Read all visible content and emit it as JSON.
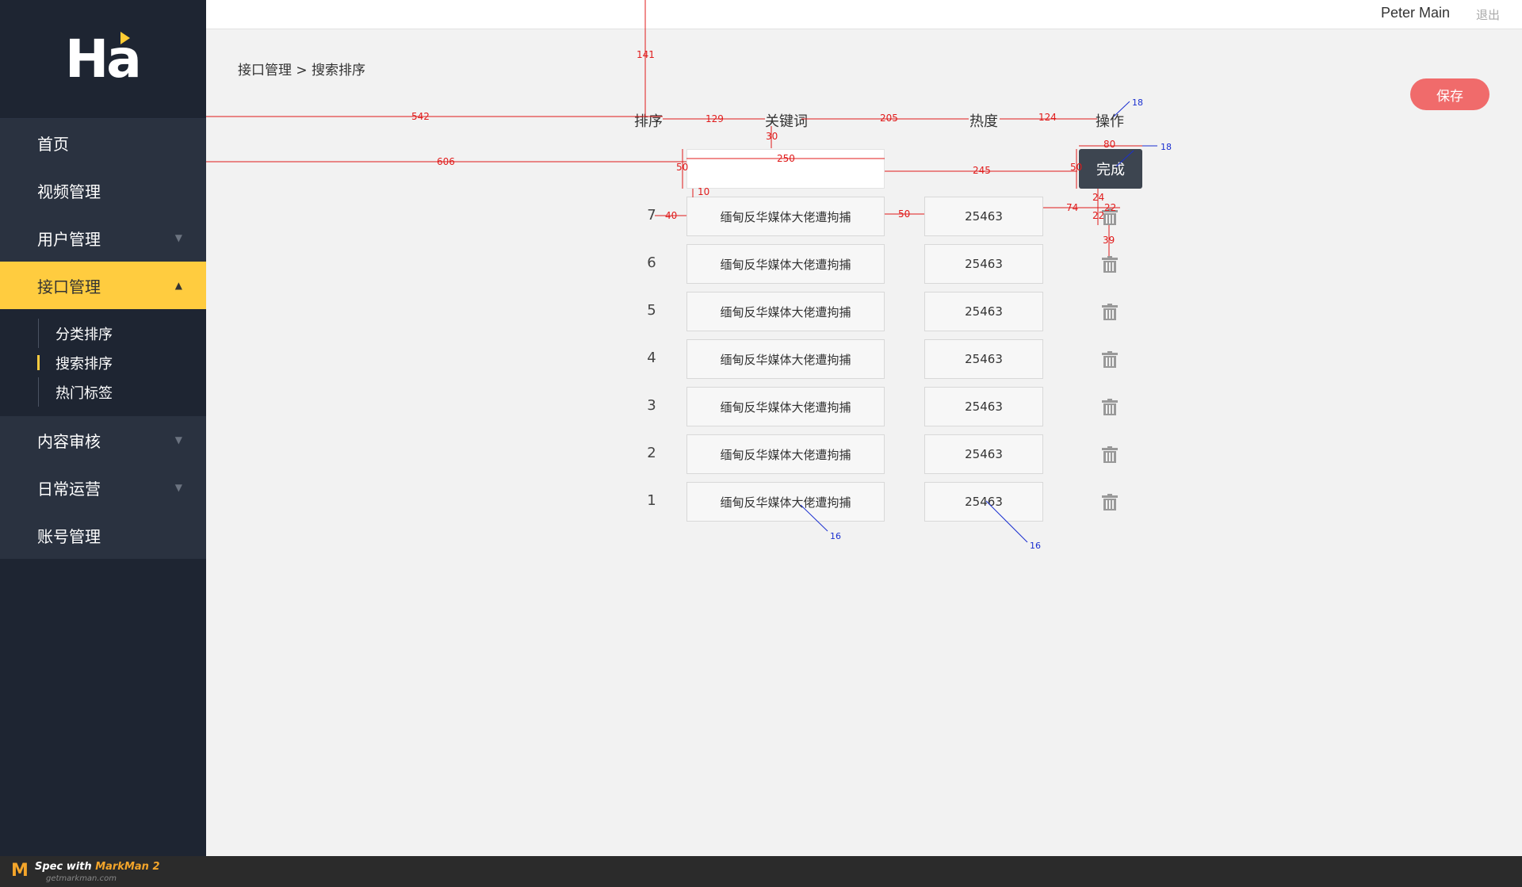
{
  "sidebar": {
    "logo": "Ha",
    "items": [
      {
        "label": "首页"
      },
      {
        "label": "视频管理"
      },
      {
        "label": "用户管理",
        "arrow": "▼"
      },
      {
        "label": "接口管理",
        "arrow": "▲"
      },
      {
        "label": "内容审核",
        "arrow": "▼"
      },
      {
        "label": "日常运营",
        "arrow": "▼"
      },
      {
        "label": "账号管理"
      }
    ],
    "submenu": [
      {
        "label": "分类排序"
      },
      {
        "label": "搜索排序"
      },
      {
        "label": "热门标签"
      }
    ]
  },
  "header": {
    "user_name": "Peter Main",
    "logout_label": "退出"
  },
  "breadcrumb": "接口管理 > 搜索排序",
  "save_label": "保存",
  "table": {
    "headers": [
      "排序",
      "关键词",
      "热度",
      "操作"
    ],
    "new_row_value": "",
    "done_label": "完成",
    "rows": [
      {
        "rank": "7",
        "keyword": "缅甸反华媒体大佬遭拘捕",
        "heat": "25463"
      },
      {
        "rank": "6",
        "keyword": "缅甸反华媒体大佬遭拘捕",
        "heat": "25463"
      },
      {
        "rank": "5",
        "keyword": "缅甸反华媒体大佬遭拘捕",
        "heat": "25463"
      },
      {
        "rank": "4",
        "keyword": "缅甸反华媒体大佬遭拘捕",
        "heat": "25463"
      },
      {
        "rank": "3",
        "keyword": "缅甸反华媒体大佬遭拘捕",
        "heat": "25463"
      },
      {
        "rank": "2",
        "keyword": "缅甸反华媒体大佬遭拘捕",
        "heat": "25463"
      },
      {
        "rank": "1",
        "keyword": "缅甸反华媒体大佬遭拘捕",
        "heat": "25463"
      }
    ]
  },
  "annotations": {
    "red": [
      "141",
      "542",
      "129",
      "205",
      "124",
      "30",
      "250",
      "606",
      "50",
      "10",
      "245",
      "80",
      "50",
      "24",
      "40",
      "50",
      "74",
      "22",
      "22",
      "39"
    ],
    "blue": [
      "18",
      "18",
      "16",
      "16"
    ]
  },
  "footer": {
    "logo": "M",
    "title_prefix": "Spec with ",
    "title_brand": "MarkMan 2",
    "url": "getmarkman.com"
  },
  "colors": {
    "sidebar_bg": "#1e2532",
    "menu_bg": "#2a3240",
    "accent": "#ffcc3f",
    "save_button": "#f06b6b",
    "done_button": "#3d4550",
    "spec_red": "#e01b1b",
    "spec_blue": "#1a2fd0"
  }
}
